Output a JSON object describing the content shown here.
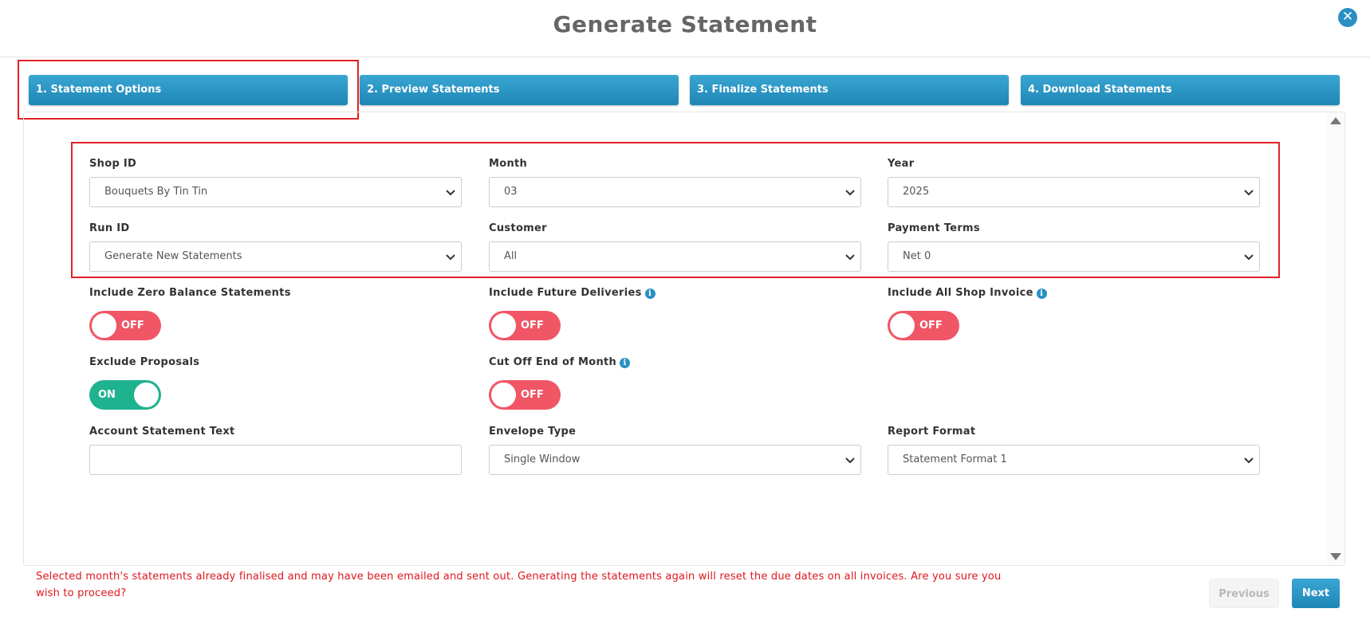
{
  "header": {
    "title": "Generate Statement",
    "close_icon": "close-icon"
  },
  "tabs": [
    {
      "label": "1. Statement Options",
      "active": true
    },
    {
      "label": "2. Preview Statements",
      "active": false
    },
    {
      "label": "3. Finalize Statements",
      "active": false
    },
    {
      "label": "4. Download Statements",
      "active": false
    }
  ],
  "fields": {
    "shop_id": {
      "label": "Shop ID",
      "value": "Bouquets By Tin Tin"
    },
    "month": {
      "label": "Month",
      "value": "03"
    },
    "year": {
      "label": "Year",
      "value": "2025"
    },
    "run_id": {
      "label": "Run ID",
      "value": "Generate New Statements"
    },
    "customer": {
      "label": "Customer",
      "value": "All"
    },
    "payment_terms": {
      "label": "Payment Terms",
      "value": "Net 0"
    },
    "account_statement_text": {
      "label": "Account Statement Text",
      "value": ""
    },
    "envelope_type": {
      "label": "Envelope Type",
      "value": "Single Window"
    },
    "report_format": {
      "label": "Report Format",
      "value": "Statement Format 1"
    }
  },
  "toggles": {
    "include_zero_balance": {
      "label": "Include Zero Balance Statements",
      "state": "OFF",
      "info": false
    },
    "include_future_deliveries": {
      "label": "Include Future Deliveries",
      "state": "OFF",
      "info": true
    },
    "include_all_shop_invoice": {
      "label": "Include All Shop Invoice",
      "state": "OFF",
      "info": true
    },
    "exclude_proposals": {
      "label": "Exclude Proposals",
      "state": "ON",
      "info": false
    },
    "cut_off_end_of_month": {
      "label": "Cut Off End of Month",
      "state": "OFF",
      "info": true
    }
  },
  "info_glyph": "i",
  "warning": "Selected month's statements already finalised and may have been emailed and sent out. Generating the statements again will reset the due dates on all invoices. Are you sure you wish to proceed?",
  "buttons": {
    "previous": "Previous",
    "next": "Next"
  },
  "colors": {
    "accent": "#2a90c4",
    "toggle_off": "#f05666",
    "toggle_on": "#1fb28f",
    "warning": "#e0161e",
    "highlight": "#e12127"
  }
}
